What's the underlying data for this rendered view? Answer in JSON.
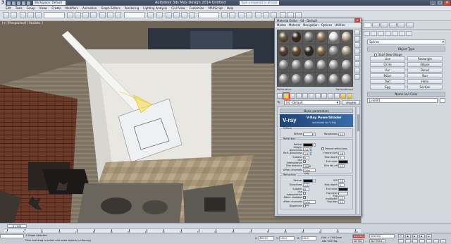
{
  "window": {
    "app_icon": "3dsmax-logo",
    "workspace": "Workspace: Default",
    "title": "Autodesk 3ds Max Design 2014   Untitled",
    "search_placeholder": "Type a keyword or phrase"
  },
  "menu": [
    "Edit",
    "Tools",
    "Group",
    "Views",
    "Create",
    "Modifiers",
    "Animation",
    "Graph Editors",
    "Rendering",
    "Lighting Analysis",
    "Civil View",
    "Customize",
    "MAXScript",
    "Help"
  ],
  "viewport": {
    "label": "[+] [Perspective] [ Realistic ]"
  },
  "command_panel": {
    "category": "Splines",
    "rollout_title": "Object Type",
    "start_new_shape": "Start New Shape",
    "object_buttons": [
      "Line",
      "Rectangle",
      "Circle",
      "Ellipse",
      "Arc",
      "Donut",
      "NGon",
      "Star",
      "Text",
      "Helix",
      "Egg",
      "Section"
    ],
    "name_rollout": "Name and Color",
    "name_value": "Line001"
  },
  "material_editor": {
    "title": "Material Editor - 04 - Default",
    "menu": [
      "Modes",
      "Material",
      "Navigation",
      "Options",
      "Utilities"
    ],
    "slot_colors": [
      [
        "#6d5a40",
        "#3a2a1c",
        "#8a8a8a",
        "#9a8262",
        "#e8e8e8",
        "#c7b79a"
      ],
      [
        "#5a4030",
        "#6a4a2a",
        "#2f2a26",
        "#8b6b45",
        "#9c9c9c",
        "#b4a890"
      ],
      [
        "#9a9a9a",
        "#a0a0a0",
        "#a6a6a6",
        "#aaaaaa",
        "#adadad",
        "#b0b0b0"
      ],
      [
        "#9a9a9a",
        "#a0a0a0",
        "#a6a6a6",
        "#aaaaaa",
        "#adadad",
        "#b0b0b0"
      ]
    ],
    "row_labels": [
      "Reflectance",
      "Transmittance"
    ],
    "material_name": "04 - Default",
    "material_type": "VRayMtl",
    "basic_params_title": "Basic parameters",
    "banner_logo": "V-ray",
    "banner_title": "V-Ray PowerShader",
    "banner_subtitle": "optimized for V-Ray",
    "diffuse": {
      "title": "Diffuse",
      "diffuse_label": "Diffuse",
      "roughness_label": "Roughness",
      "roughness_value": "0.0",
      "color": "#ffffff"
    },
    "reflection": {
      "title": "Reflection",
      "reflect_label": "Reflect",
      "reflect_color": "#111111",
      "hilight_label": "Hilight. glossiness",
      "hilight_value": "1.0",
      "refl_gloss_label": "Refl. glossiness",
      "refl_gloss_value": "1.0",
      "fresnel_label": "Fresnel reflections",
      "fresnel_ior_label": "Fresnel IOR",
      "fresnel_ior_value": "1.6",
      "subdivs_label": "Subdivs",
      "subdivs_value": "8",
      "max_depth_label": "Max depth",
      "max_depth_value": "5",
      "use_interp_label": "Use interpolation",
      "exit_color_label": "Exit color",
      "exit_color": "#111111",
      "dim_distance_label": "Dim distance",
      "dim_distance_value": "100.0",
      "dim_falloff_label": "Dim fall off",
      "dim_falloff_value": "0.0",
      "affect_channels_label": "Affect channels",
      "affect_channels_value": "Color only"
    },
    "refraction": {
      "title": "Refraction",
      "refract_label": "Refract",
      "refract_color": "#111111",
      "ior_label": "IOR",
      "ior_value": "1.6",
      "glossiness_label": "Glossiness",
      "glossiness_value": "1.0",
      "max_depth_label": "Max depth",
      "max_depth_value": "5",
      "subdivs_label": "Subdivs",
      "subdivs_value": "8",
      "exit_color_label": "Exit color",
      "exit_color": "#111111",
      "use_interp_label": "Use interpolation",
      "fog_color_label": "Fog color",
      "fog_color": "#ffffff",
      "affect_shadows_label": "Affect shadows",
      "fog_mult_label": "Fog multiplier",
      "fog_mult_value": "1.0",
      "fog_bias_label": "Fog bias",
      "fog_bias_value": "0.0",
      "affect_channels_label": "Affect channels",
      "affect_channels_value": "Color only",
      "dispersion_label": "Dispersion"
    }
  },
  "timeline": {
    "frame_counter": "0 / 100",
    "ticks": [
      "0",
      "5",
      "10",
      "15",
      "20",
      "25",
      "30",
      "35",
      "40",
      "45",
      "50",
      "55",
      "60",
      "65",
      "70",
      "75",
      "80",
      "85",
      "90",
      "95",
      "100"
    ]
  },
  "status": {
    "selection": "1 Shape Selected",
    "prompt": "Click and drag to select and scale objects (uniformly)",
    "x_label": "X:",
    "x_value": "89.515",
    "y_label": "Y:",
    "y_value": "100.0",
    "z_label": "Z:",
    "z_value": "100.0",
    "grid": "Grid = 100.0mm",
    "auto_key": "Auto Key",
    "selected": "Selected",
    "set_key": "Set Key",
    "key_filters": "Key Filters...",
    "add_time_tag": "Add Time Tag"
  }
}
